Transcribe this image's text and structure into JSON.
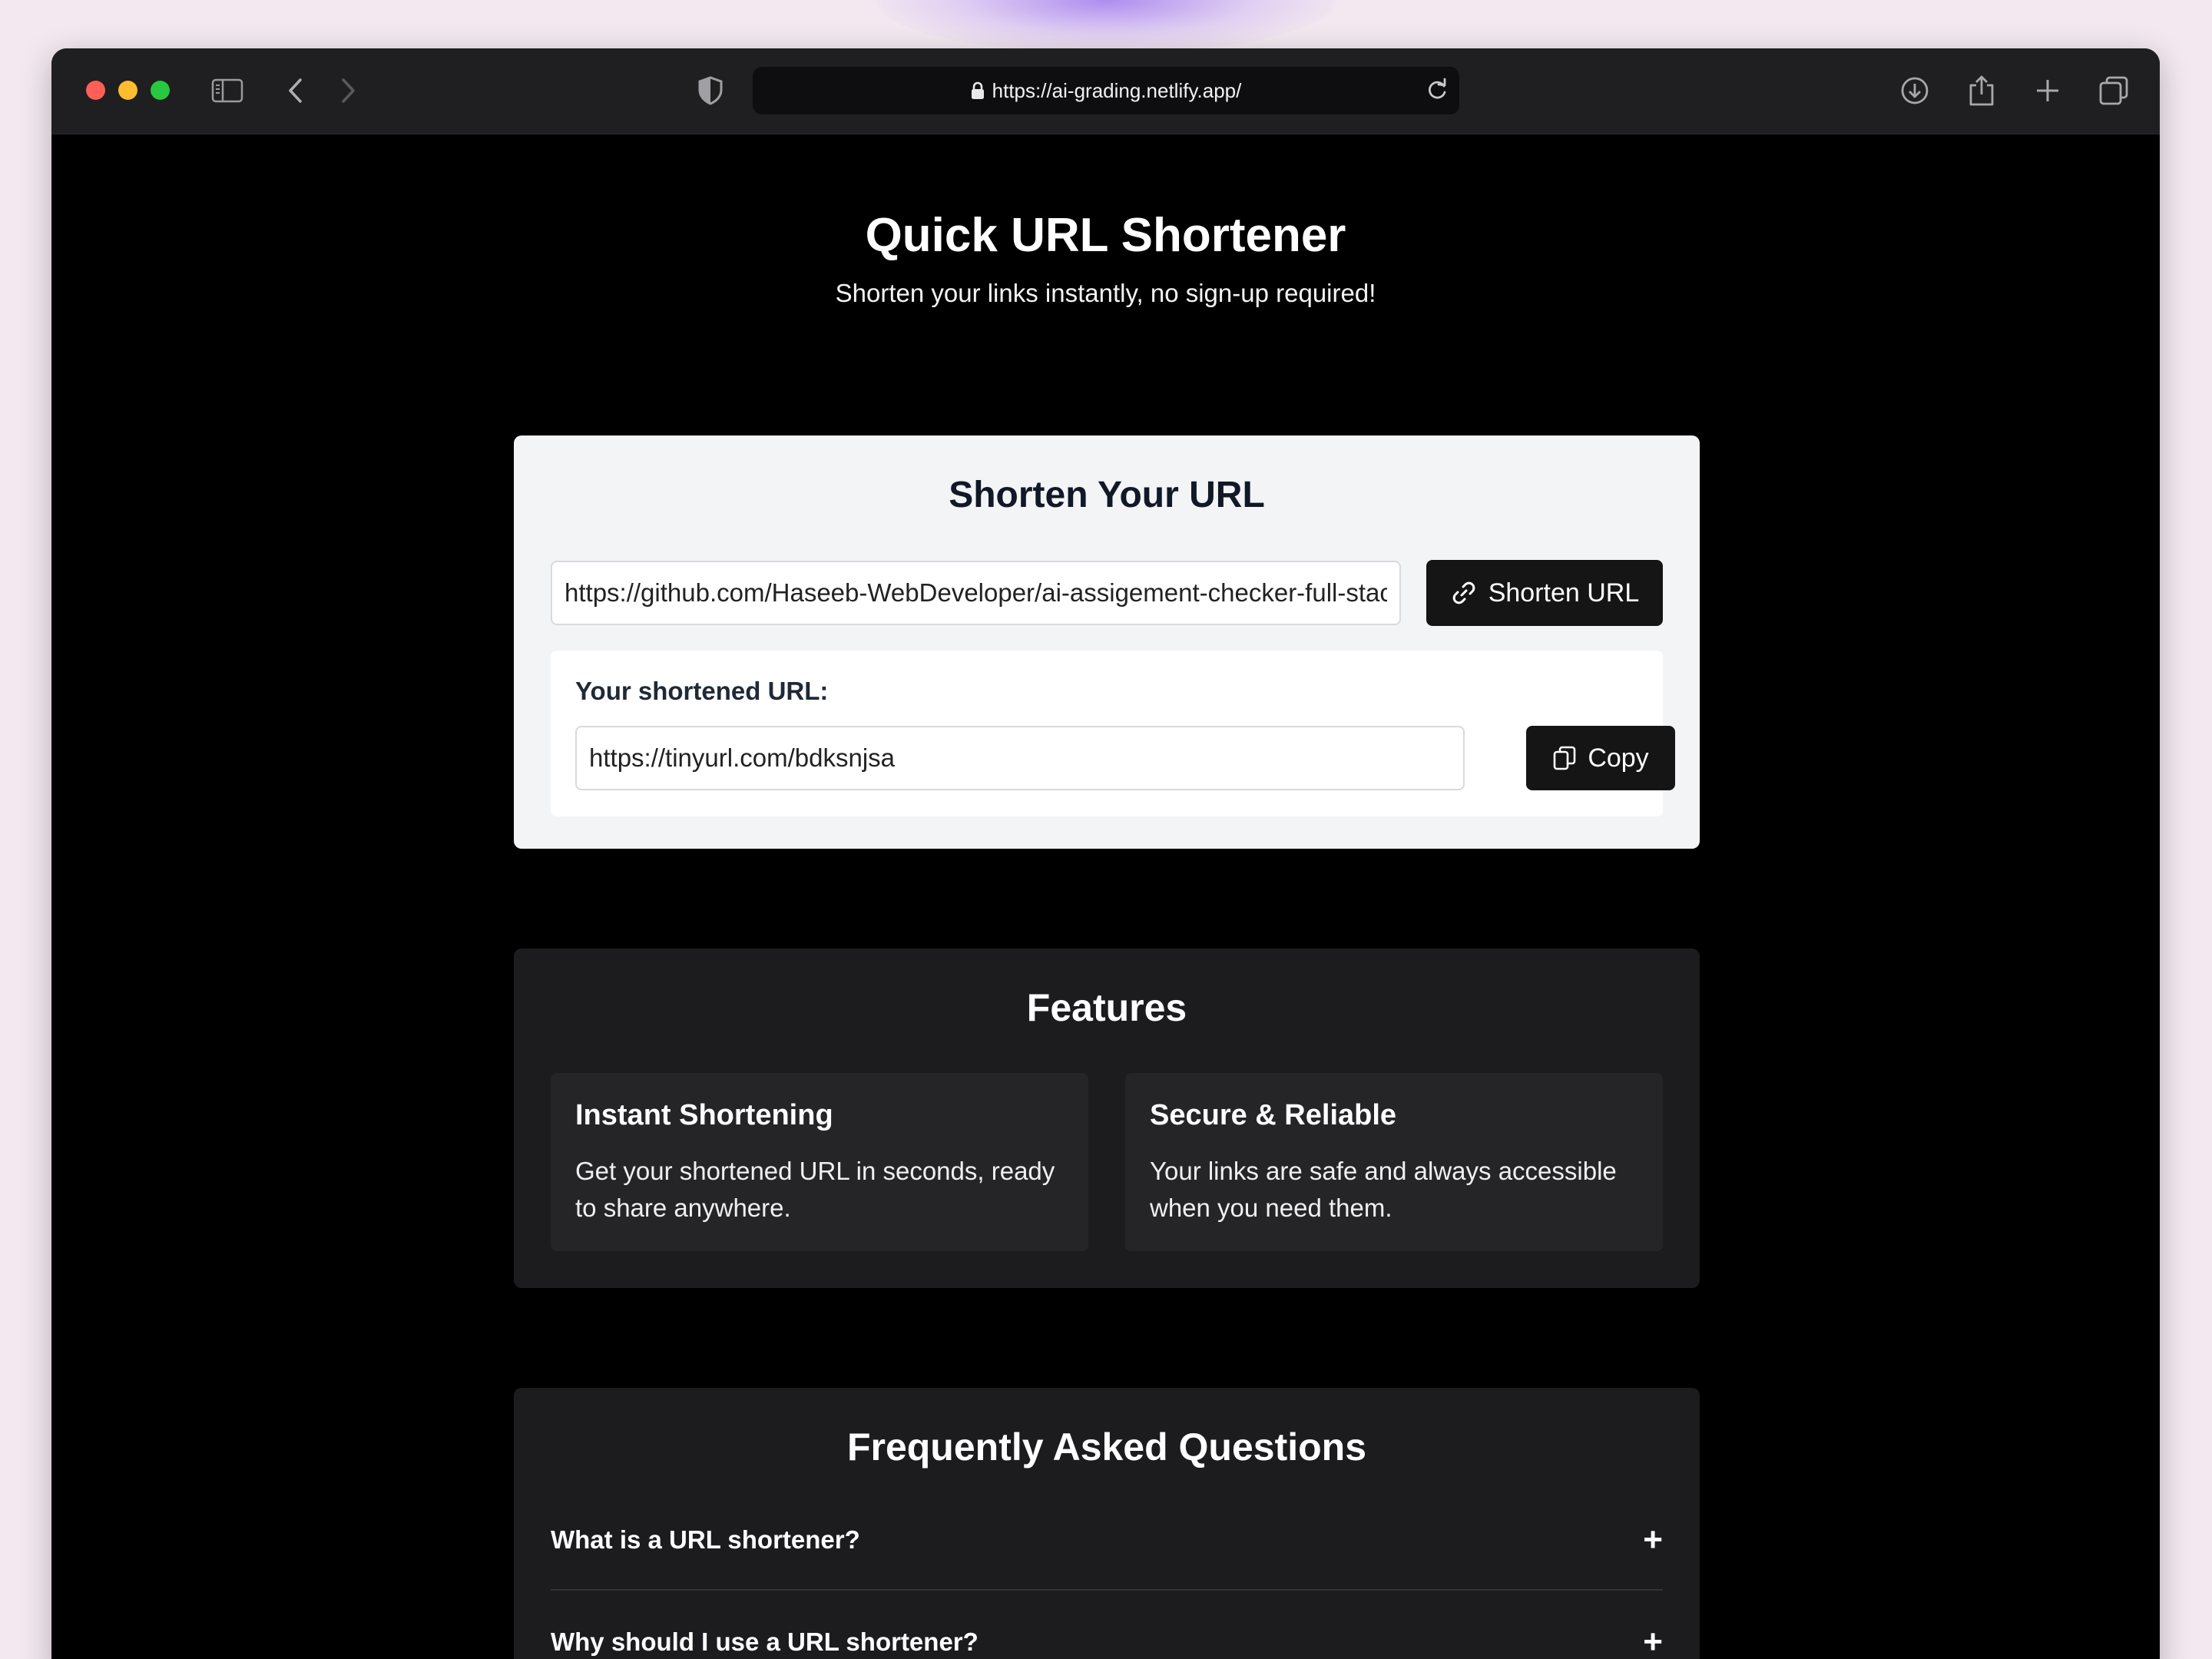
{
  "browser": {
    "url": "https://ai-grading.netlify.app/"
  },
  "hero": {
    "title": "Quick URL Shortener",
    "subtitle": "Shorten your links instantly, no sign-up required!"
  },
  "shortener": {
    "title": "Shorten Your URL",
    "input_value": "https://github.com/Haseeb-WebDeveloper/ai-assigement-checker-full-stack",
    "shorten_label": "Shorten URL",
    "result_label": "Your shortened URL:",
    "result_value": "https://tinyurl.com/bdksnjsa",
    "copy_label": "Copy"
  },
  "features": {
    "title": "Features",
    "items": [
      {
        "title": "Instant Shortening",
        "description": "Get your shortened URL in seconds, ready to share anywhere."
      },
      {
        "title": "Secure & Reliable",
        "description": "Your links are safe and always accessible when you need them."
      }
    ]
  },
  "faq": {
    "title": "Frequently Asked Questions",
    "items": [
      {
        "question": "What is a URL shortener?",
        "toggle": "+"
      },
      {
        "question": "Why should I use a URL shortener?",
        "toggle": "+"
      }
    ]
  },
  "colors": {
    "page_bg": "#000000",
    "card_light": "#f3f4f6",
    "card_dark": "#1c1c1e",
    "button_dark": "#151515"
  }
}
